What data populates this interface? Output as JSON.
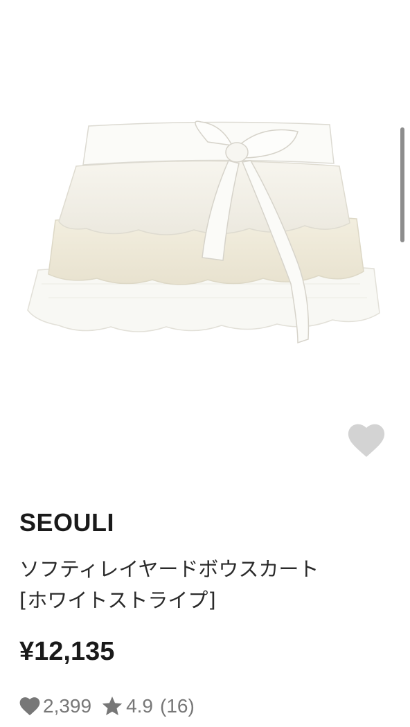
{
  "product": {
    "brand": "SEOULI",
    "title_line1": "ソフティレイヤードボウスカート",
    "title_line2": "[ホワイトストライプ]",
    "price": "¥12,135",
    "likes": "2,399",
    "rating": "4.9",
    "review_count": "(16)"
  },
  "icons": {
    "favorite": "heart-icon",
    "likes": "heart-icon",
    "rating": "star-icon"
  },
  "colors": {
    "icon_gray": "#777777",
    "favorite_gray": "#d3d3d3",
    "text_dark": "#1a1a1a"
  }
}
